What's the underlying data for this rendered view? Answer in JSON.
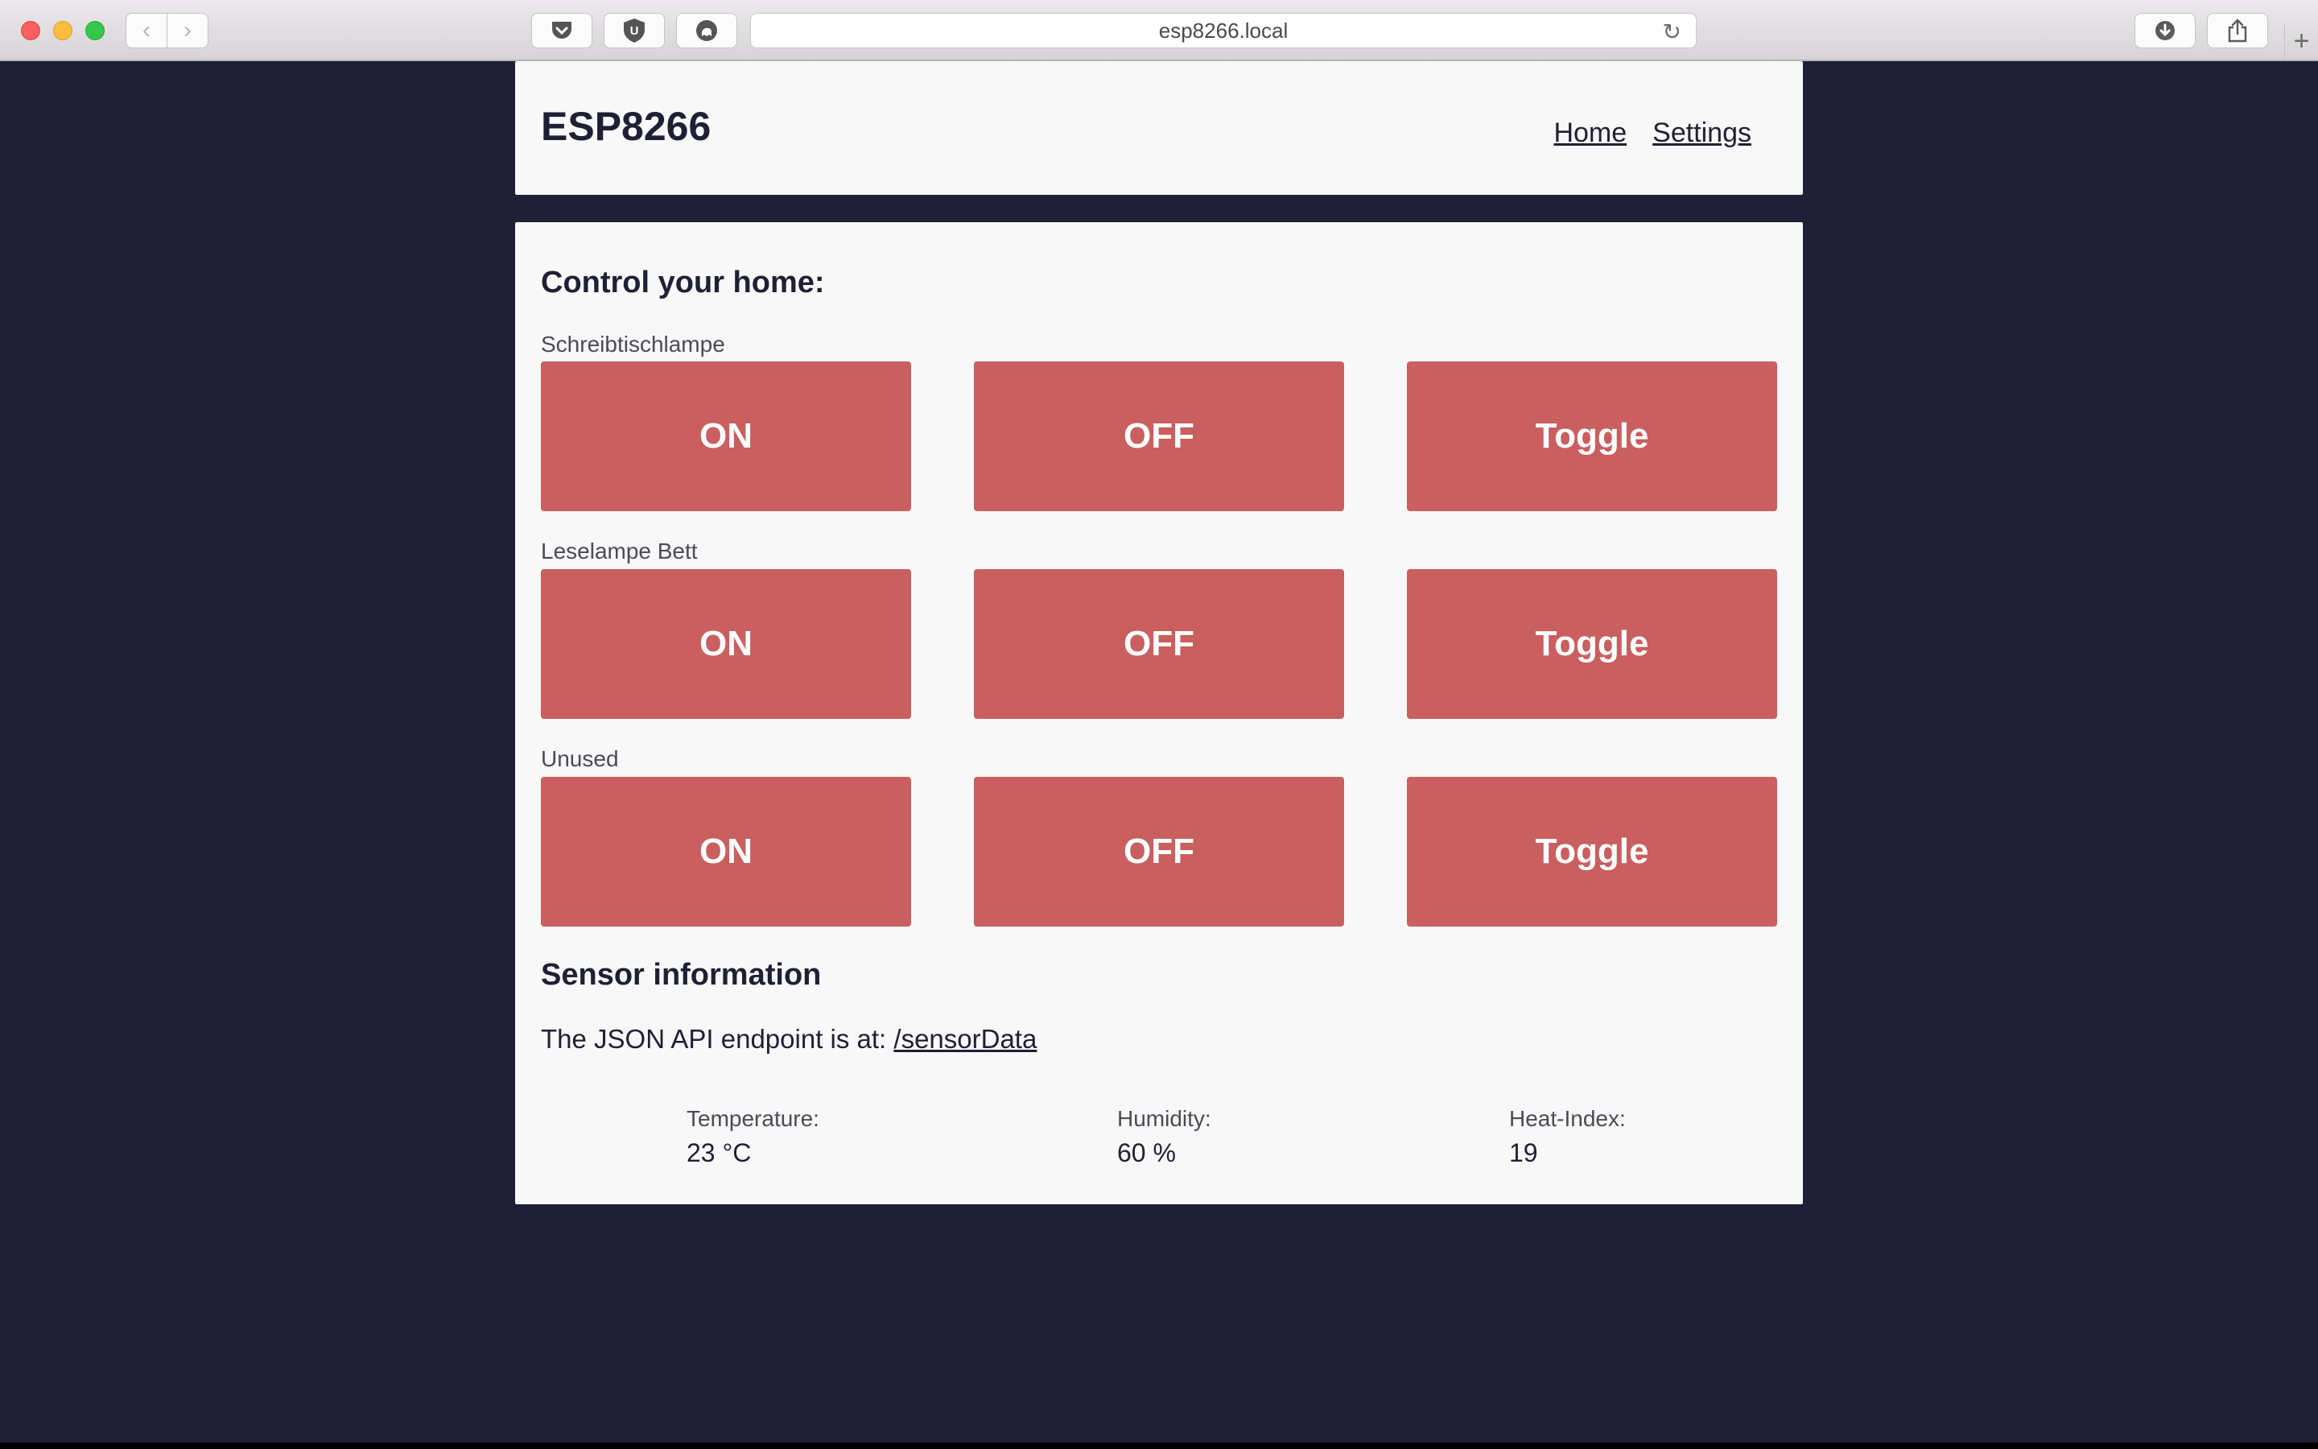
{
  "browser": {
    "url": "esp8266.local",
    "back_glyph": "‹",
    "forward_glyph": "›",
    "reload_glyph": "↻",
    "newtab_glyph": "+",
    "ublock_letter": "U"
  },
  "header": {
    "brand": "ESP8266",
    "nav": {
      "home": "Home",
      "settings": "Settings"
    }
  },
  "control": {
    "title": "Control your home:",
    "devices": [
      {
        "name": "Schreibtischlampe",
        "on": "ON",
        "off": "OFF",
        "toggle": "Toggle"
      },
      {
        "name": "Leselampe Bett",
        "on": "ON",
        "off": "OFF",
        "toggle": "Toggle"
      },
      {
        "name": "Unused",
        "on": "ON",
        "off": "OFF",
        "toggle": "Toggle"
      }
    ]
  },
  "sensor": {
    "title": "Sensor information",
    "api_text": "The JSON API endpoint is at: ",
    "api_link": "/sensorData",
    "readings": {
      "temperature": {
        "label": "Temperature:",
        "value": "23 °C"
      },
      "humidity": {
        "label": "Humidity:",
        "value": "60 %"
      },
      "heat_index": {
        "label": "Heat-Index:",
        "value": "19"
      }
    }
  },
  "colors": {
    "background": "#1f2035",
    "card": "#f8f8f8",
    "button": "#c95f5f"
  }
}
